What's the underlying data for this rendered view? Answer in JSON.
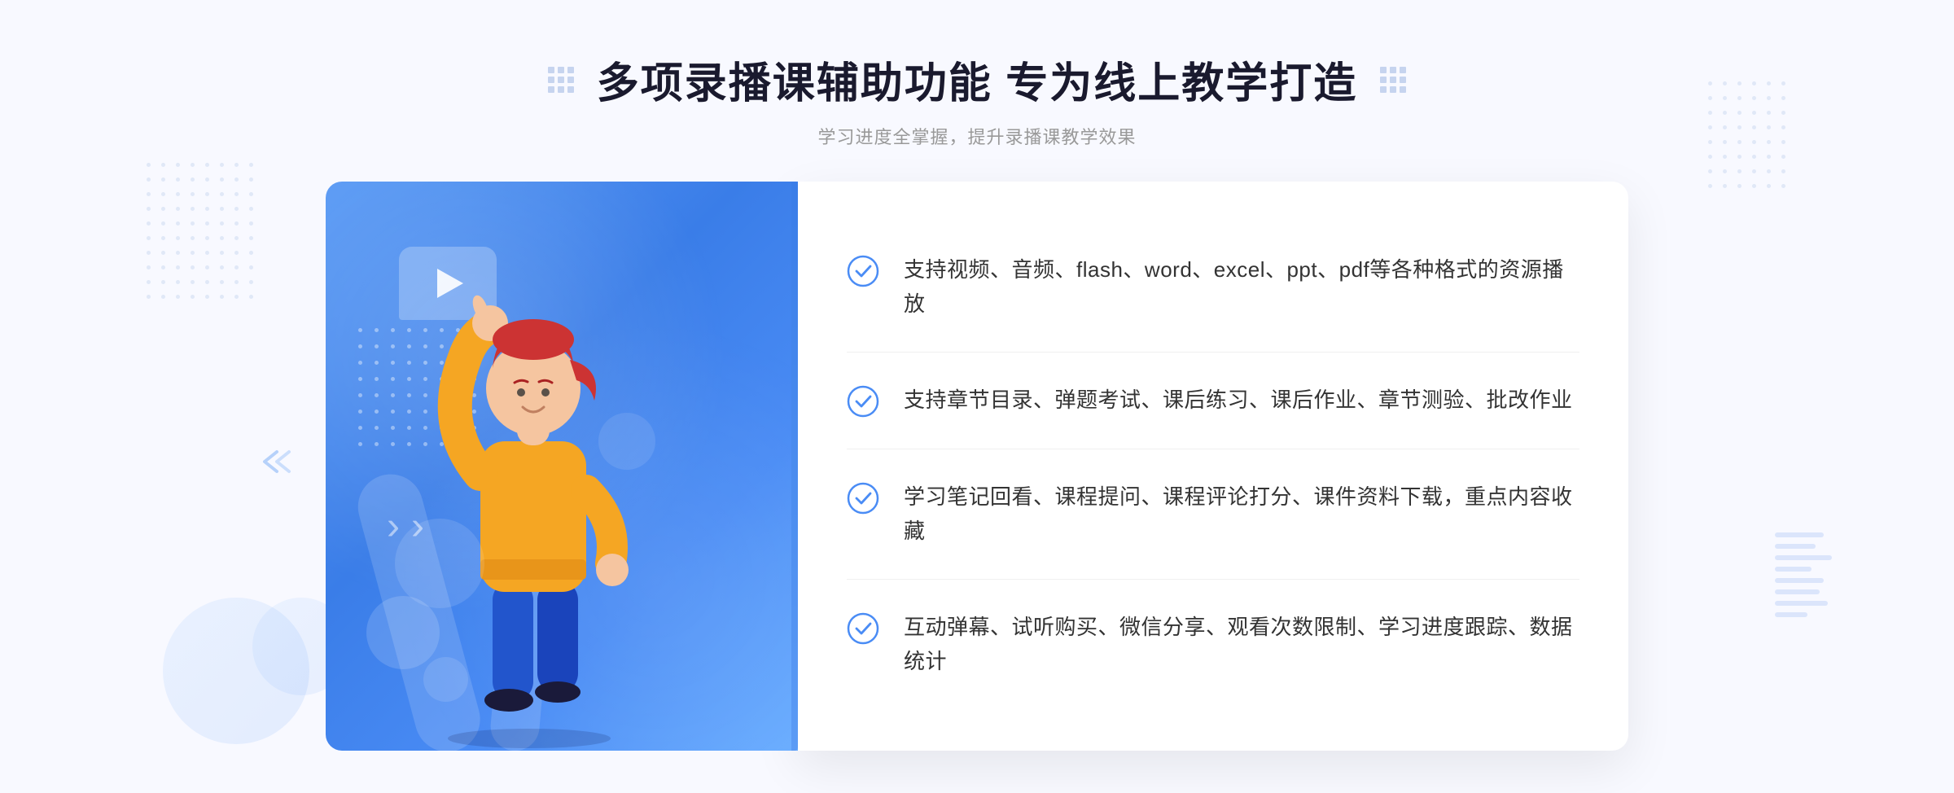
{
  "page": {
    "background": "#f5f7ff"
  },
  "header": {
    "title": "多项录播课辅助功能 专为线上教学打造",
    "subtitle": "学习进度全掌握，提升录播课教学效果"
  },
  "features": [
    {
      "id": "feature-1",
      "text": "支持视频、音频、flash、word、excel、ppt、pdf等各种格式的资源播放",
      "icon": "check-circle"
    },
    {
      "id": "feature-2",
      "text": "支持章节目录、弹题考试、课后练习、课后作业、章节测验、批改作业",
      "icon": "check-circle"
    },
    {
      "id": "feature-3",
      "text": "学习笔记回看、课程提问、课程评论打分、课件资料下载，重点内容收藏",
      "icon": "check-circle"
    },
    {
      "id": "feature-4",
      "text": "互动弹幕、试听购买、微信分享、观看次数限制、学习进度跟踪、数据统计",
      "icon": "check-circle"
    }
  ],
  "illustration": {
    "bg_gradient_start": "#5b9bf5",
    "bg_gradient_end": "#3a7de8"
  },
  "decorations": {
    "arrow_left": "»",
    "grid_dots": true
  }
}
